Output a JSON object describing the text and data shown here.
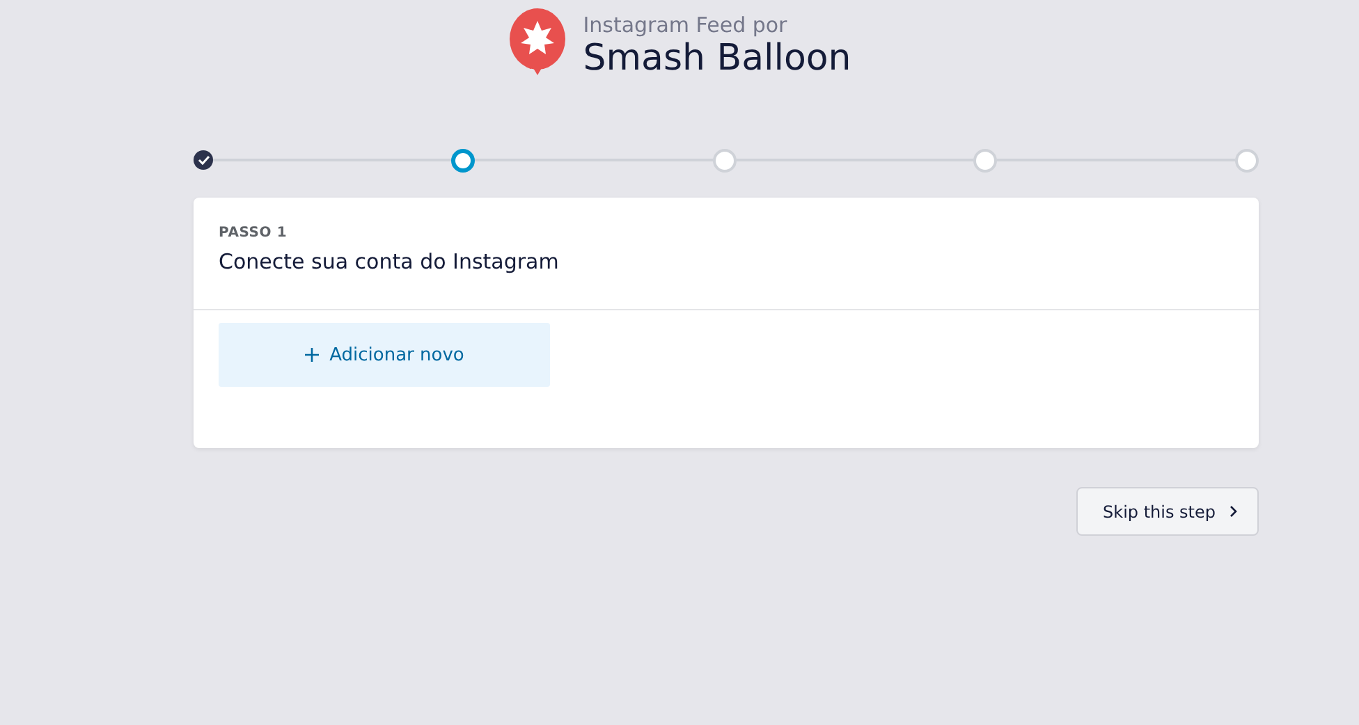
{
  "header": {
    "subtitle": "Instagram Feed por",
    "title": "Smash Balloon"
  },
  "steps": [
    {
      "completed": true,
      "selected": false
    },
    {
      "completed": false,
      "selected": true
    },
    {
      "completed": false,
      "selected": false
    },
    {
      "completed": false,
      "selected": false
    },
    {
      "completed": false,
      "selected": false
    }
  ],
  "card": {
    "eyebrow": "PASSO 1",
    "heading": "Conecte sua conta do Instagram",
    "add_button": "Adicionar novo"
  },
  "skip_button": "Skip this step"
}
